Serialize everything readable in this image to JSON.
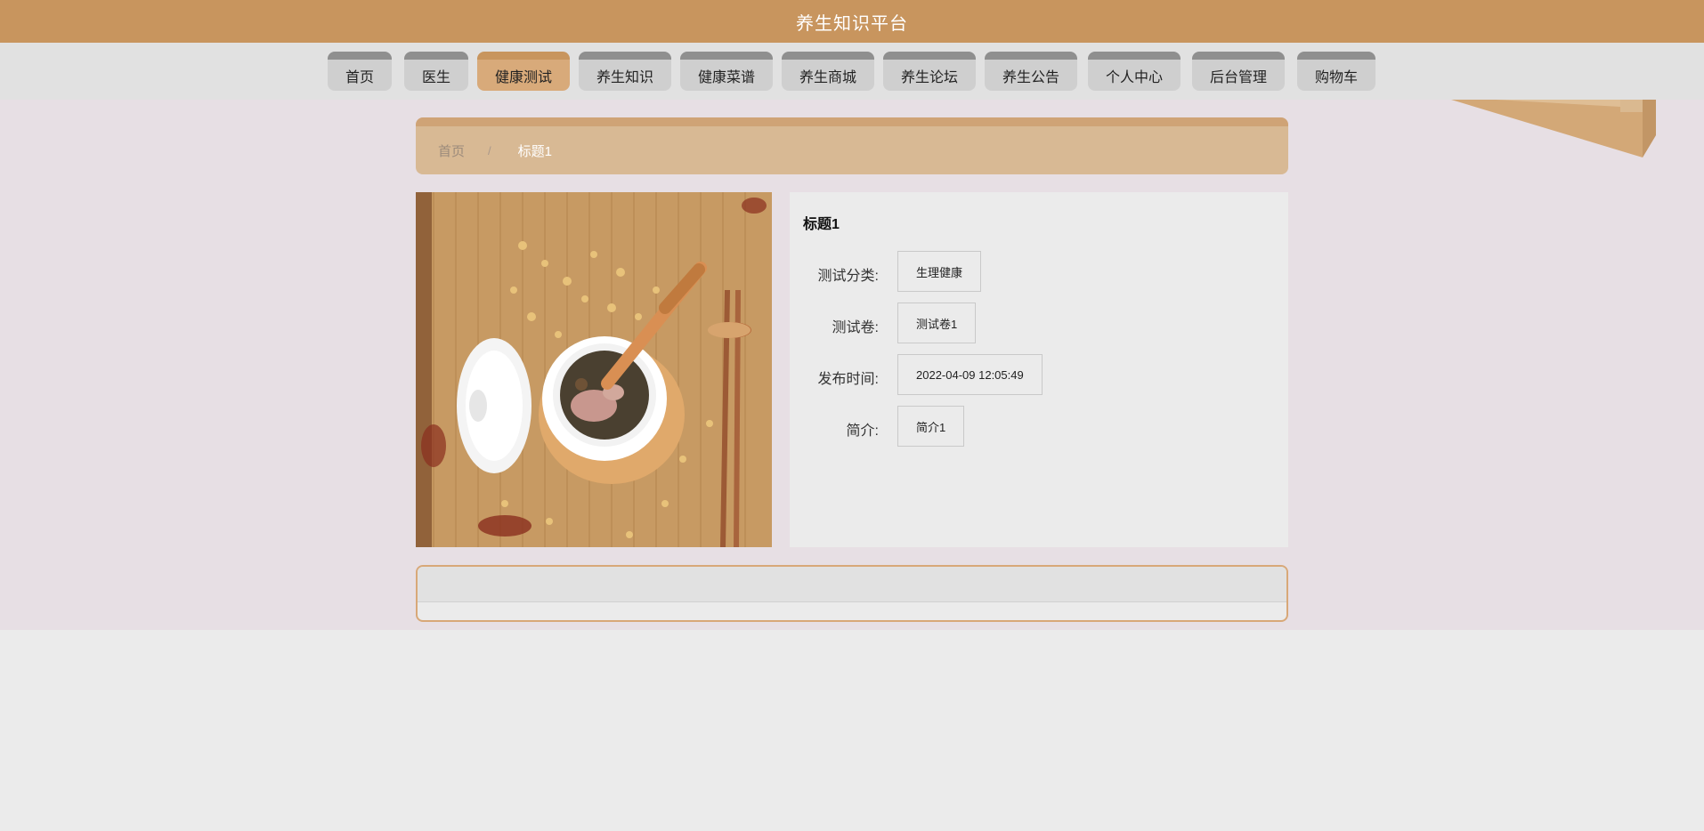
{
  "header": {
    "title": "养生知识平台"
  },
  "nav": {
    "items": [
      {
        "label": "首页"
      },
      {
        "label": "医生"
      },
      {
        "label": "健康测试"
      },
      {
        "label": "养生知识"
      },
      {
        "label": "健康菜谱"
      },
      {
        "label": "养生商城"
      },
      {
        "label": "养生论坛"
      },
      {
        "label": "养生公告"
      },
      {
        "label": "个人中心"
      },
      {
        "label": "后台管理"
      },
      {
        "label": "购物车"
      }
    ],
    "active_index": 2
  },
  "breadcrumb": {
    "home": "首页",
    "separator": "/",
    "current": "标题1"
  },
  "detail": {
    "title": "标题1",
    "fields": [
      {
        "label": "测试分类:",
        "value": "生理健康"
      },
      {
        "label": "测试卷:",
        "value": "测试卷1"
      },
      {
        "label": "发布时间:",
        "value": "2022-04-09 12:05:49"
      },
      {
        "label": "简介:",
        "value": "简介1"
      }
    ]
  },
  "image": {
    "subject": "soup-pot-with-chopsticks"
  },
  "colors": {
    "header_bg": "#c8955e",
    "active_tab": "#d8aa7a",
    "breadcrumb_bg": "#d8b994",
    "content_bg": "#e7dfe4"
  }
}
